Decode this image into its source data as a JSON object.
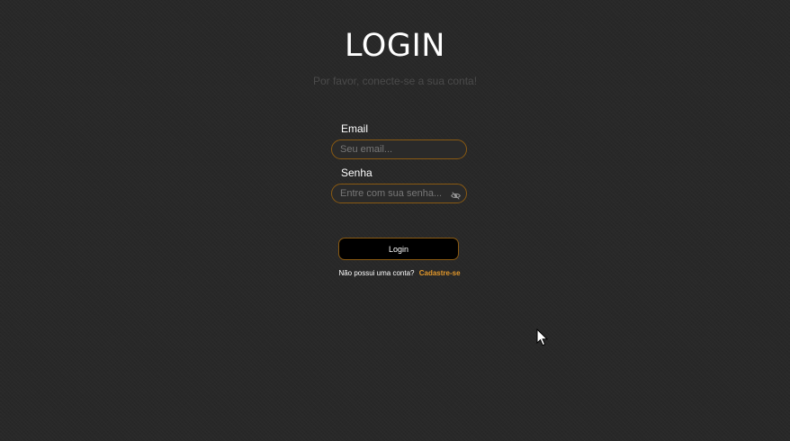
{
  "page": {
    "title": "LOGIN",
    "subtitle": "Por favor, conecte-se a sua conta!"
  },
  "form": {
    "email": {
      "label": "Email",
      "value": "",
      "placeholder": "Seu email..."
    },
    "password": {
      "label": "Senha",
      "value": "",
      "placeholder": "Entre com sua senha...",
      "toggle_icon": "eye-slash-icon"
    },
    "submit_label": "Login"
  },
  "signup": {
    "prompt": "Não possui uma conta?",
    "link_label": "Cadastre-se"
  },
  "colors": {
    "background": "#282828",
    "accent": "#e0962a",
    "field_border": "#8a5a12",
    "button_bg": "#000000",
    "text": "#ffffff",
    "subtitle": "#4a4a4a"
  },
  "cursor_icon": "mouse-pointer-icon"
}
